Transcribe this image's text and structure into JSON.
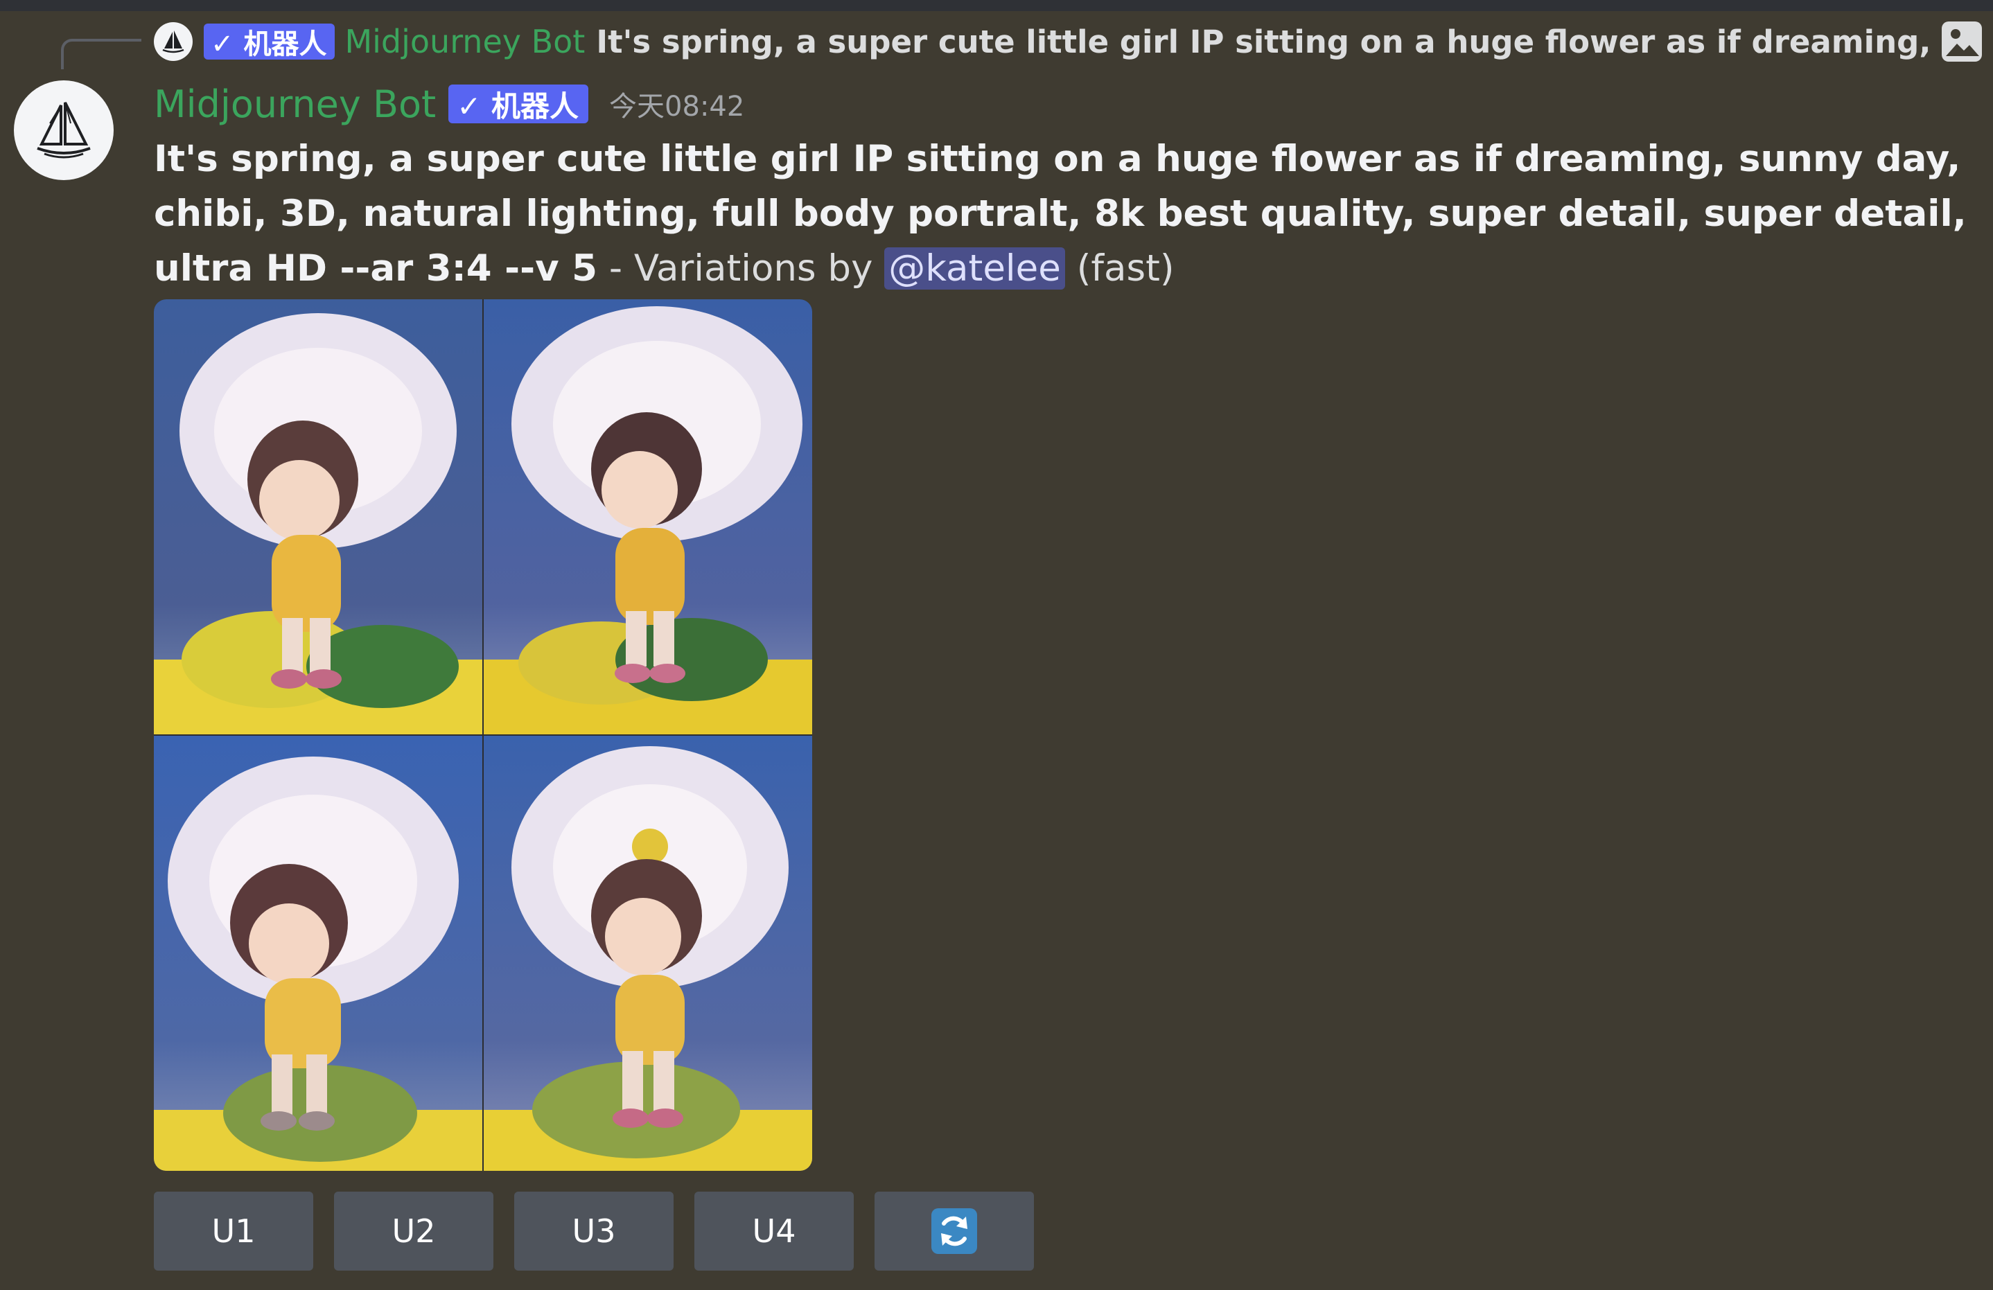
{
  "reply": {
    "bot_tag": "✓ 机器人",
    "author": "Midjourney Bot",
    "preview_text": "It's spring, a super cute little girl IP sitting on a huge flower as if dreaming, sunny day, c"
  },
  "header": {
    "author": "Midjourney Bot",
    "bot_tag": "✓ 机器人",
    "timestamp": "今天08:42"
  },
  "message": {
    "prompt": "It's spring, a super cute little girl IP sitting on a huge flower as if dreaming, sunny day, chibi, 3D, natural lighting, full body portralt, 8k best quality, super detail, super detail, ultra HD --ar 3:4 --v 5",
    "suffix": " - Variations by ",
    "mention": "@katelee",
    "speed": " (fast)"
  },
  "buttons": {
    "u1": "U1",
    "u2": "U2",
    "u3": "U3",
    "u4": "U4",
    "reroll_icon": "refresh-icon"
  },
  "colors": {
    "background": "#3f3b31",
    "bot_green": "#3ba55d",
    "bot_tag": "#5865f2",
    "button": "#4f545c",
    "mention_bg": "#4a4f8a"
  }
}
